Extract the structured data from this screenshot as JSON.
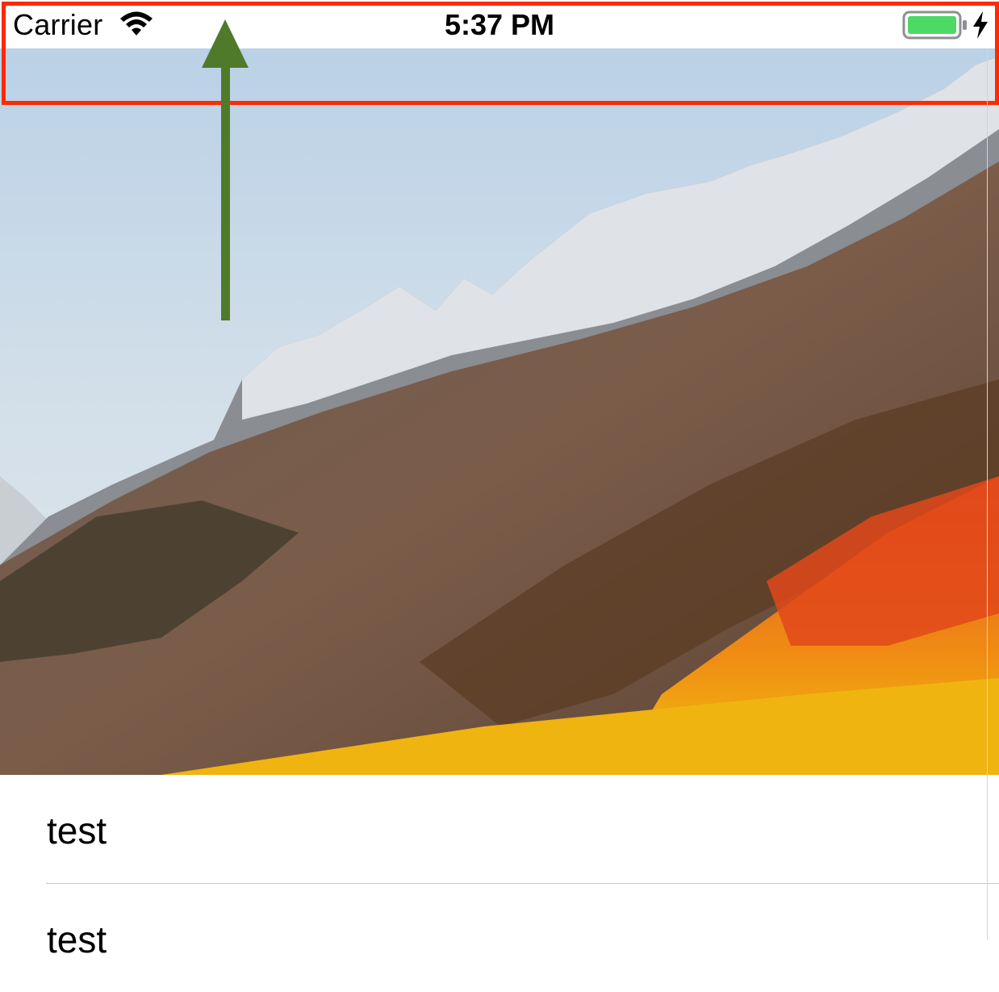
{
  "status_bar": {
    "carrier": "Carrier",
    "time": "5:37 PM",
    "battery_color": "#4cd964",
    "icons": [
      "wifi-icon",
      "battery-icon",
      "charging-bolt-icon"
    ]
  },
  "header_image": {
    "subject": "mountain-landscape"
  },
  "annotations": {
    "highlight_color": "#ff2a00",
    "arrow_color": "#4f7a2a"
  },
  "table": {
    "rows": [
      {
        "label": "test"
      },
      {
        "label": "test"
      }
    ]
  }
}
